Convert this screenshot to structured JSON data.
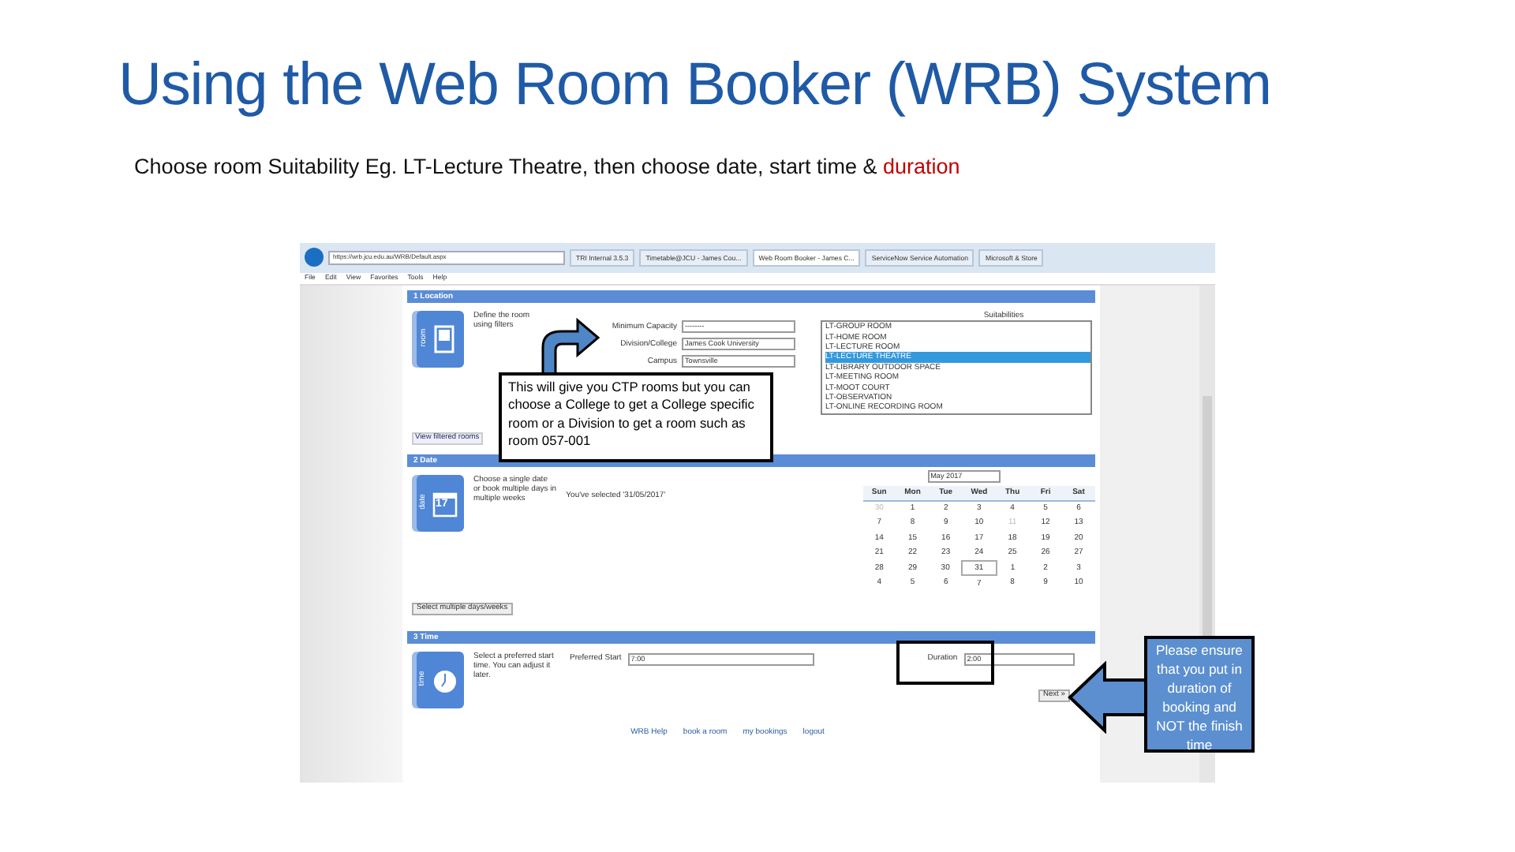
{
  "title": "Using the Web Room Booker (WRB) System",
  "subtitle": {
    "text": "Choose room Suitability Eg. LT-Lecture Theatre, then choose date, start time &",
    "highlight": "duration"
  },
  "browser": {
    "address": "https://wrb.jcu.edu.au/WRB/Default.aspx",
    "tabs": [
      {
        "label": "TRI Internal 3.5.3",
        "selected": false
      },
      {
        "label": "Timetable@JCU - James Cou...",
        "selected": false
      },
      {
        "label": "Web Room Booker - James C...",
        "selected": true
      },
      {
        "label": "ServiceNow Service Automation",
        "selected": false
      },
      {
        "label": "Microsoft & Store",
        "selected": false
      }
    ],
    "menu": [
      "File",
      "Edit",
      "View",
      "Favorites",
      "Tools",
      "Help"
    ]
  },
  "location": {
    "heading": "1  Location",
    "icon_label": "room",
    "description": "Define the room using filters",
    "fields": [
      {
        "label": "Minimum Capacity",
        "value": "--------"
      },
      {
        "label": "Division/College",
        "value": "James Cook University"
      },
      {
        "label": "Campus",
        "value": "Townsville"
      }
    ],
    "suitabilities_label": "Suitabilities",
    "suitabilities": [
      {
        "label": "LT-GROUP ROOM",
        "selected": false
      },
      {
        "label": "LT-HOME ROOM",
        "selected": false
      },
      {
        "label": "LT-LECTURE ROOM",
        "selected": false
      },
      {
        "label": "LT-LECTURE THEATRE",
        "selected": true
      },
      {
        "label": "LT-LIBRARY OUTDOOR SPACE",
        "selected": false
      },
      {
        "label": "LT-MEETING ROOM",
        "selected": false
      },
      {
        "label": "LT-MOOT COURT",
        "selected": false
      },
      {
        "label": "LT-OBSERVATION",
        "selected": false
      },
      {
        "label": "LT-ONLINE RECORDING ROOM",
        "selected": false
      }
    ],
    "link": "View filtered rooms"
  },
  "date": {
    "heading": "2  Date",
    "icon_label": "date",
    "icon_number": "17",
    "description": "Choose a single date or book multiple days in multiple weeks",
    "selected_text": "You've selected '31/05/2017'",
    "button": "Select multiple days/weeks",
    "month": "May 2017",
    "weekdays": [
      "Sun",
      "Mon",
      "Tue",
      "Wed",
      "Thu",
      "Fri",
      "Sat"
    ],
    "weeks": [
      [
        {
          "d": "30",
          "muted": true,
          "selected": false
        },
        {
          "d": "1",
          "muted": false,
          "selected": false
        },
        {
          "d": "2",
          "muted": false,
          "selected": false
        },
        {
          "d": "3",
          "muted": false,
          "selected": false
        },
        {
          "d": "4",
          "muted": false,
          "selected": false
        },
        {
          "d": "5",
          "muted": false,
          "selected": false
        },
        {
          "d": "6",
          "muted": false,
          "selected": false
        }
      ],
      [
        {
          "d": "7",
          "muted": false,
          "selected": false
        },
        {
          "d": "8",
          "muted": false,
          "selected": false
        },
        {
          "d": "9",
          "muted": false,
          "selected": false
        },
        {
          "d": "10",
          "muted": false,
          "selected": false
        },
        {
          "d": "11",
          "muted": true,
          "selected": false
        },
        {
          "d": "12",
          "muted": false,
          "selected": false
        },
        {
          "d": "13",
          "muted": false,
          "selected": false
        }
      ],
      [
        {
          "d": "14",
          "muted": false,
          "selected": false
        },
        {
          "d": "15",
          "muted": false,
          "selected": false
        },
        {
          "d": "16",
          "muted": false,
          "selected": false
        },
        {
          "d": "17",
          "muted": false,
          "selected": false
        },
        {
          "d": "18",
          "muted": false,
          "selected": false
        },
        {
          "d": "19",
          "muted": false,
          "selected": false
        },
        {
          "d": "20",
          "muted": false,
          "selected": false
        }
      ],
      [
        {
          "d": "21",
          "muted": false,
          "selected": false
        },
        {
          "d": "22",
          "muted": false,
          "selected": false
        },
        {
          "d": "23",
          "muted": false,
          "selected": false
        },
        {
          "d": "24",
          "muted": false,
          "selected": false
        },
        {
          "d": "25",
          "muted": false,
          "selected": false
        },
        {
          "d": "26",
          "muted": false,
          "selected": false
        },
        {
          "d": "27",
          "muted": false,
          "selected": false
        }
      ],
      [
        {
          "d": "28",
          "muted": false,
          "selected": false
        },
        {
          "d": "29",
          "muted": false,
          "selected": false
        },
        {
          "d": "30",
          "muted": false,
          "selected": false
        },
        {
          "d": "31",
          "muted": false,
          "selected": true
        },
        {
          "d": "1",
          "muted": false,
          "selected": false
        },
        {
          "d": "2",
          "muted": false,
          "selected": false
        },
        {
          "d": "3",
          "muted": false,
          "selected": false
        }
      ],
      [
        {
          "d": "4",
          "muted": false,
          "selected": false
        },
        {
          "d": "5",
          "muted": false,
          "selected": false
        },
        {
          "d": "6",
          "muted": false,
          "selected": false
        },
        {
          "d": "7",
          "muted": false,
          "selected": false
        },
        {
          "d": "8",
          "muted": false,
          "selected": false
        },
        {
          "d": "9",
          "muted": false,
          "selected": false
        },
        {
          "d": "10",
          "muted": false,
          "selected": false
        }
      ]
    ]
  },
  "time": {
    "heading": "3  Time",
    "icon_label": "time",
    "description": "Select a preferred start time. You can adjust it later.",
    "start_label": "Preferred Start",
    "start_value": "7:00",
    "duration_label": "Duration",
    "duration_value": "2:00",
    "next_button": "Next »"
  },
  "footer_links": [
    "WRB Help",
    "book a room",
    "my bookings",
    "logout"
  ],
  "callouts": [
    {
      "kind": "note",
      "text": "This will give you CTP rooms but you can choose a College to get a College specific room or a Division to get a room such as room 057-001"
    },
    {
      "kind": "arrow",
      "text": "Please ensure that you put in duration of booking and NOT the finish time"
    }
  ]
}
